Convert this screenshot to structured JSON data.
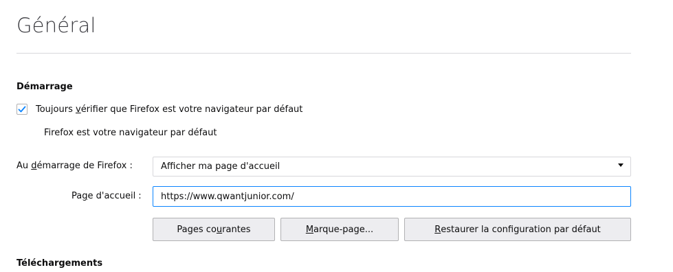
{
  "page": {
    "title": "Général"
  },
  "startup": {
    "heading": "Démarrage",
    "default_check": {
      "checked": true,
      "label_before": "Toujours ",
      "label_access": "v",
      "label_after": "érifier que Firefox est votre navigateur par défaut"
    },
    "status": "Firefox est votre navigateur par défaut",
    "on_start": {
      "label_before": "Au ",
      "label_access": "d",
      "label_after": "émarrage de Firefox :",
      "selected": "Afficher ma page d'accueil"
    },
    "homepage": {
      "label_before": "Pa",
      "label_access": "g",
      "label_after": "e d'accueil :",
      "value": "https://www.qwantjunior.com/"
    },
    "buttons": {
      "current_pages": {
        "before": "Pages co",
        "access": "u",
        "after": "rantes"
      },
      "bookmark": {
        "before": "",
        "access": "M",
        "after": "arque-page..."
      },
      "restore": {
        "before": "",
        "access": "R",
        "after": "estaurer la configuration par défaut"
      }
    }
  },
  "downloads": {
    "heading": "Téléchargements"
  },
  "colors": {
    "accent": "#0a84ff",
    "divider": "#d7d7db",
    "button_bg": "#ededf0"
  }
}
